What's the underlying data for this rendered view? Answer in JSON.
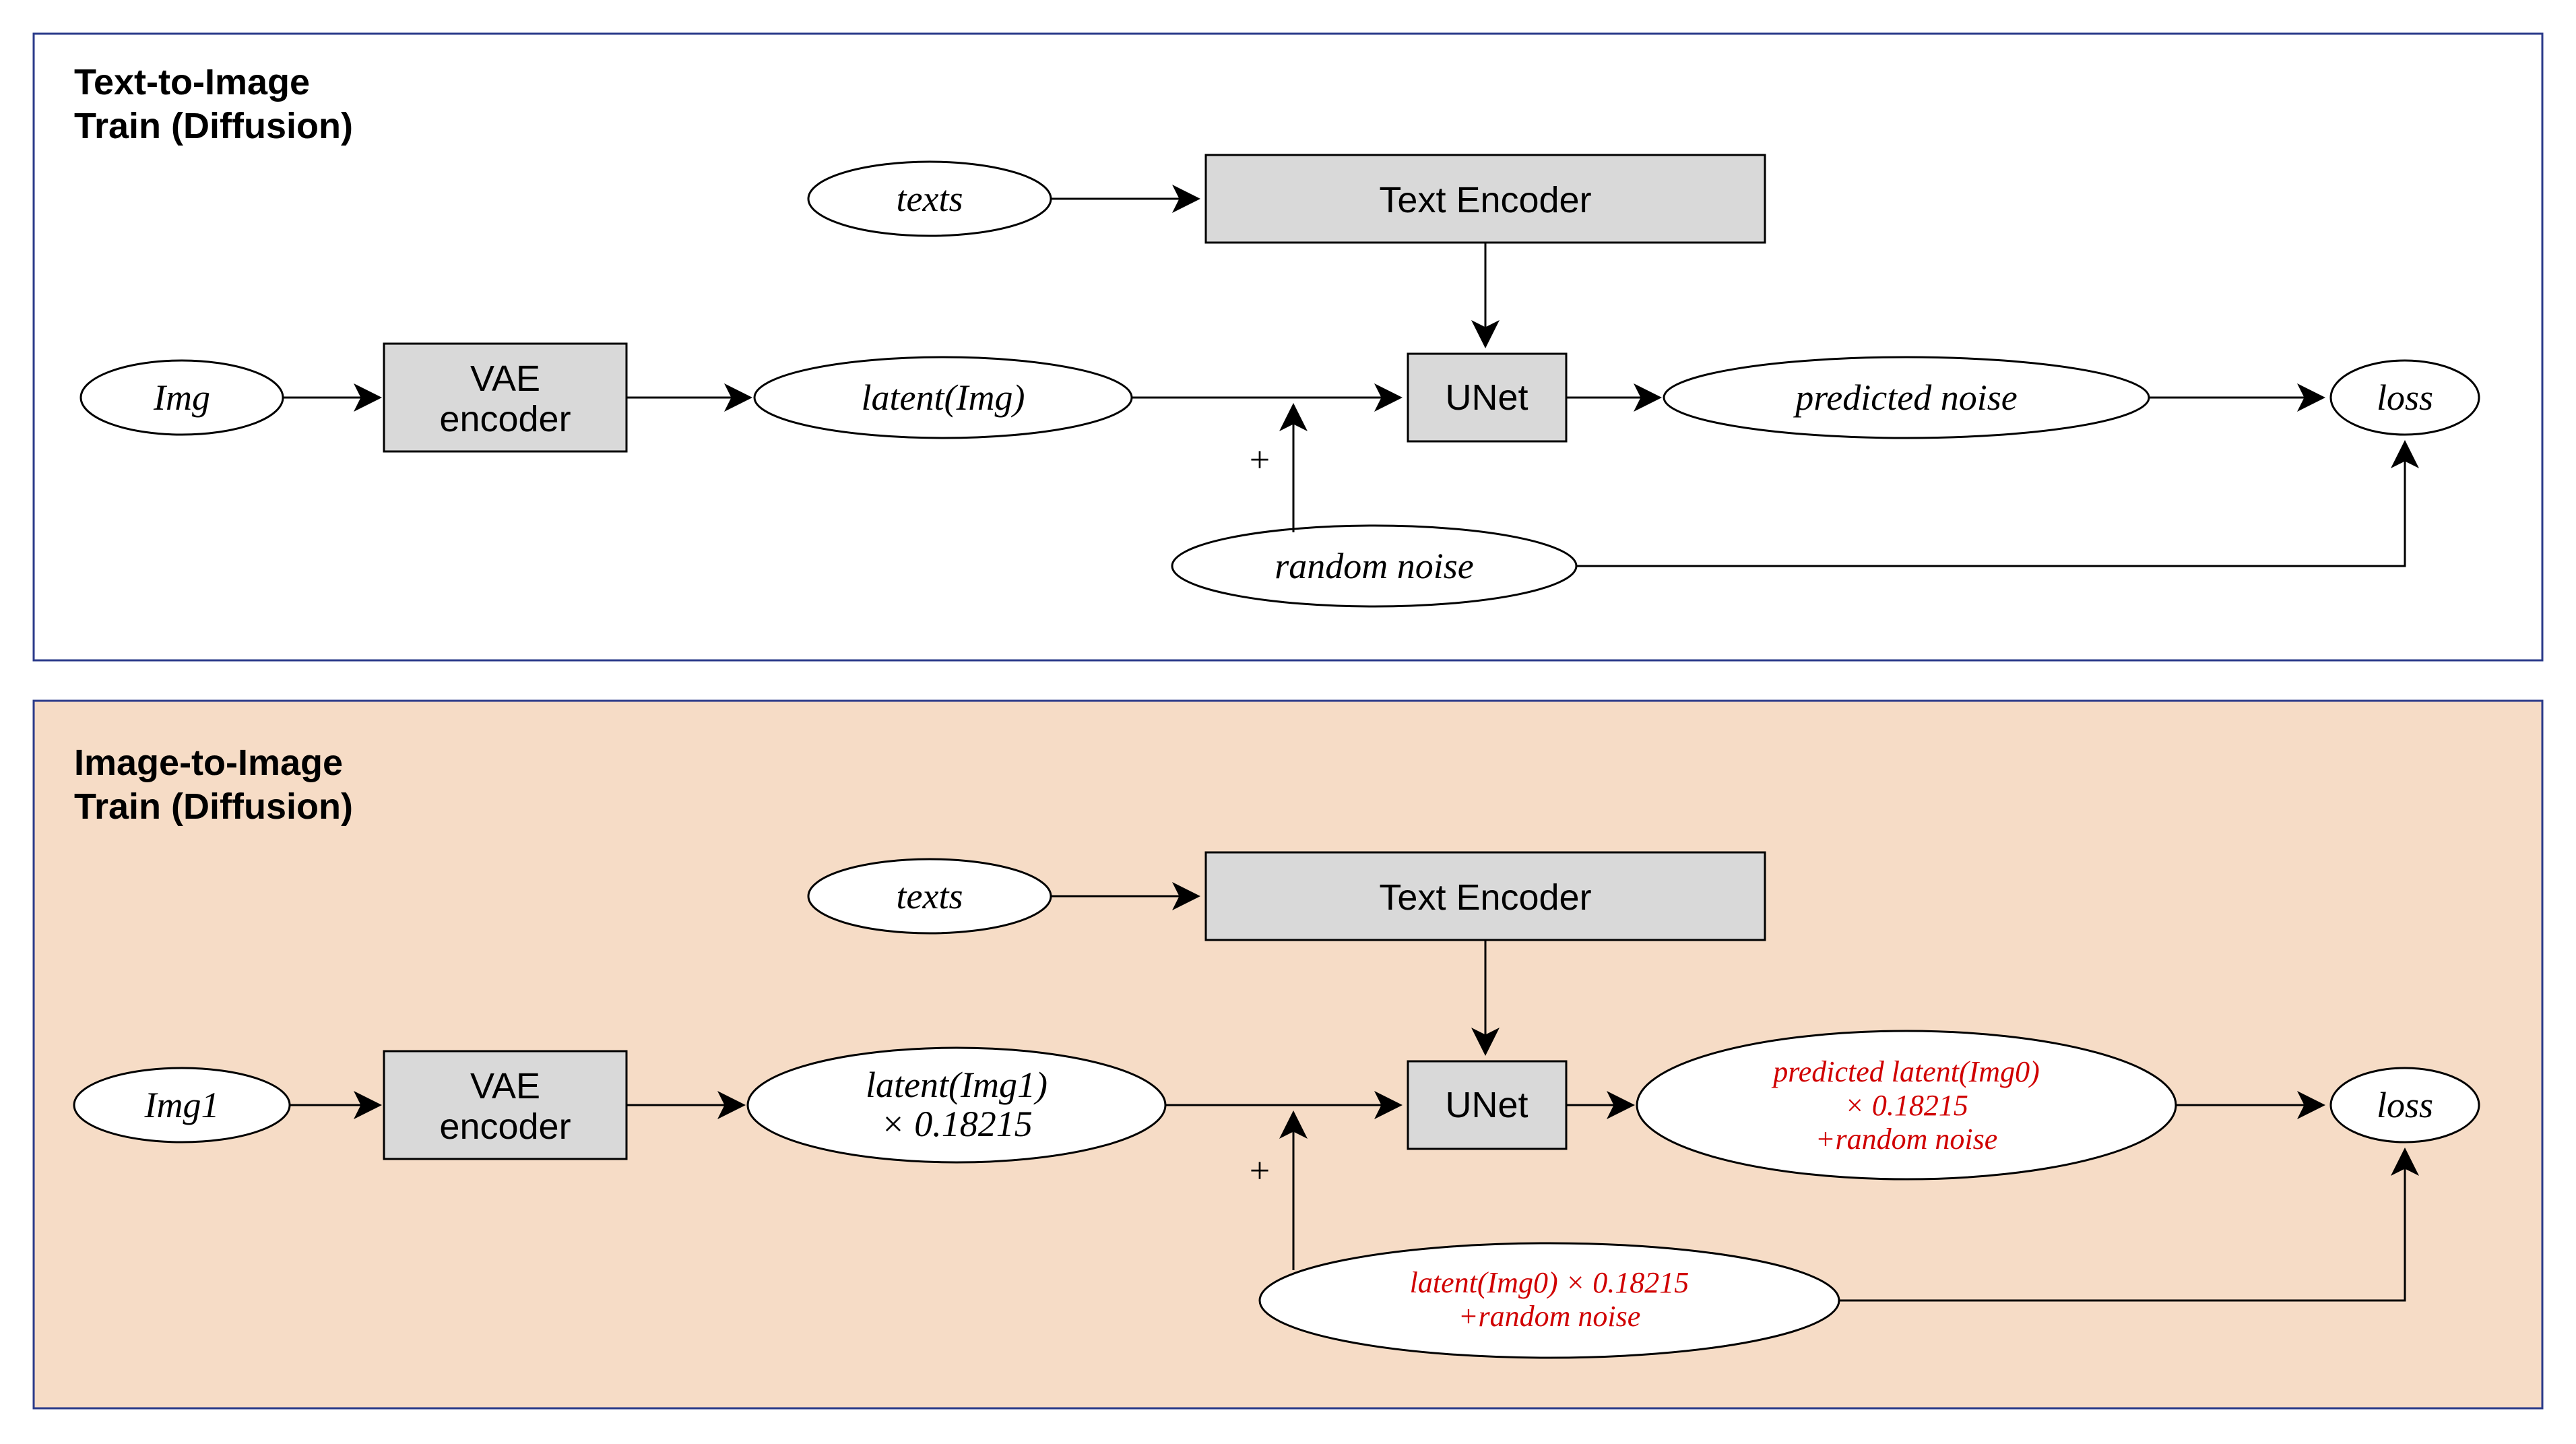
{
  "panels": {
    "top": {
      "title_line1": "Text-to-Image",
      "title_line2": "Train (Diffusion)"
    },
    "bottom": {
      "title_line1": "Image-to-Image",
      "title_line2": "Train (Diffusion)"
    }
  },
  "top": {
    "img": "Img",
    "vae_line1": "VAE",
    "vae_line2": "encoder",
    "latent": "latent(Img)",
    "texts": "texts",
    "text_encoder": "Text Encoder",
    "unet": "UNet",
    "plus": "+",
    "random_noise": "random noise",
    "predicted_noise": "predicted noise",
    "loss": "loss"
  },
  "bottom": {
    "img": "Img1",
    "vae_line1": "VAE",
    "vae_line2": "encoder",
    "latent_line1": "latent(Img1)",
    "latent_line2": "× 0.18215",
    "texts": "texts",
    "text_encoder": "Text Encoder",
    "unet": "UNet",
    "plus": "+",
    "noise_line1": "latent(Img0) × 0.18215",
    "noise_line2": "+random noise",
    "pred_line1": "predicted latent(Img0)",
    "pred_line2": "× 0.18215",
    "pred_line3": "+random noise",
    "loss": "loss"
  },
  "colors": {
    "box_fill": "#d9d9d9",
    "panel_border": "#2a3a8a",
    "bottom_bg": "#f6dcc6",
    "red": "#d00000"
  }
}
